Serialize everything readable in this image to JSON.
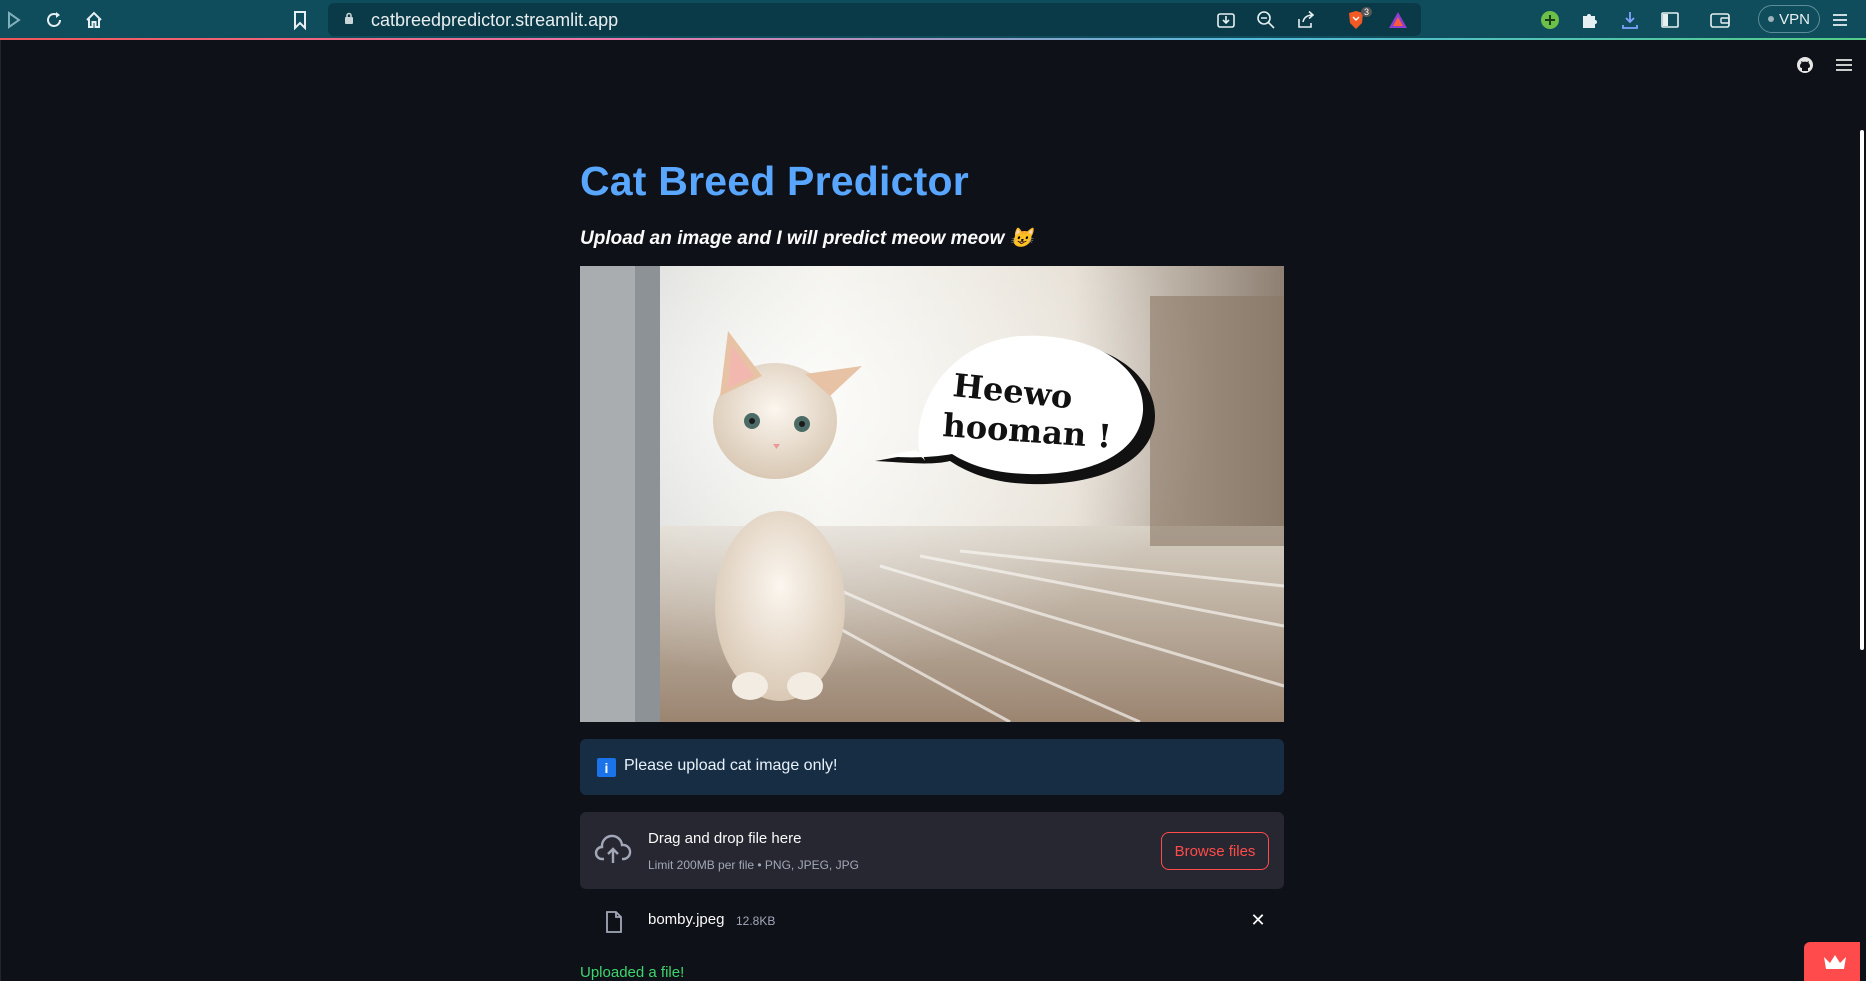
{
  "browser": {
    "url": "catbreedpredictor.streamlit.app",
    "brave_badge_count": "3",
    "vpn_label": "VPN"
  },
  "app": {
    "title": "Cat Breed Predictor",
    "subtitle": "Upload an image and I will predict meow meow 😺",
    "hero_speech": [
      "Heewo",
      "hooman !"
    ],
    "info_icon": "i",
    "info_text": "Please upload cat image only!",
    "uploader": {
      "drag_text": "Drag and drop file here",
      "limit_text": "Limit 200MB per file • PNG, JPEG, JPG",
      "browse_label": "Browse files"
    },
    "file": {
      "name": "bomby.jpeg",
      "size": "12.8KB",
      "remove_symbol": "✕"
    },
    "status": "Uploaded a file!"
  },
  "colors": {
    "title": "#58a6ff",
    "accent": "#ff4b4b",
    "success": "#3dd56d",
    "info_bg": "#172d43",
    "uploader_bg": "#262730",
    "browser_bar": "#0f4c5c"
  }
}
